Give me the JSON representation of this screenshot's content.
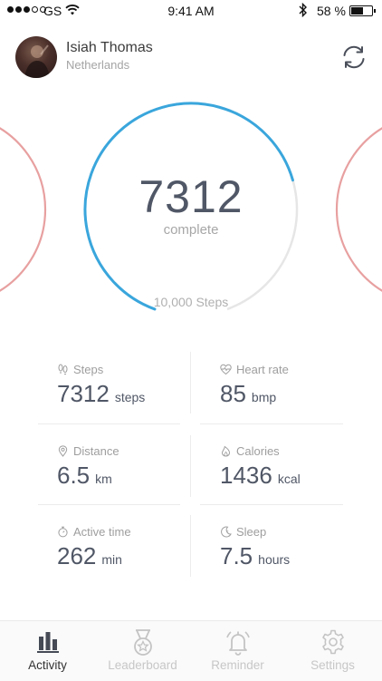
{
  "status_bar": {
    "carrier": "GS",
    "time": "9:41 AM",
    "battery_pct": "58 %",
    "battery_level": 0.58,
    "signal_bars": 5,
    "signal_filled": 3
  },
  "profile": {
    "name": "Isiah Thomas",
    "country": "Netherlands"
  },
  "activity": {
    "steps_value": "7312",
    "status": "complete",
    "goal_label": "10,000 Steps",
    "progress": 0.7312,
    "ring_color": "#3aa6dc",
    "side_ring_color": "#e8a0a0"
  },
  "stats": {
    "steps": {
      "label": "Steps",
      "value": "7312",
      "unit": "steps"
    },
    "heart": {
      "label": "Heart rate",
      "value": "85",
      "unit": "bmp"
    },
    "distance": {
      "label": "Distance",
      "value": "6.5",
      "unit": "km"
    },
    "calories": {
      "label": "Calories",
      "value": "1436",
      "unit": "kcal"
    },
    "active": {
      "label": "Active time",
      "value": "262",
      "unit": "min"
    },
    "sleep": {
      "label": "Sleep",
      "value": "7.5",
      "unit": "hours"
    }
  },
  "tabs": [
    {
      "label": "Activity",
      "icon": "bar-chart-icon",
      "active": true
    },
    {
      "label": "Leaderboard",
      "icon": "medal-icon",
      "active": false
    },
    {
      "label": "Reminder",
      "icon": "bell-icon",
      "active": false
    },
    {
      "label": "Settings",
      "icon": "gear-icon",
      "active": false
    }
  ]
}
